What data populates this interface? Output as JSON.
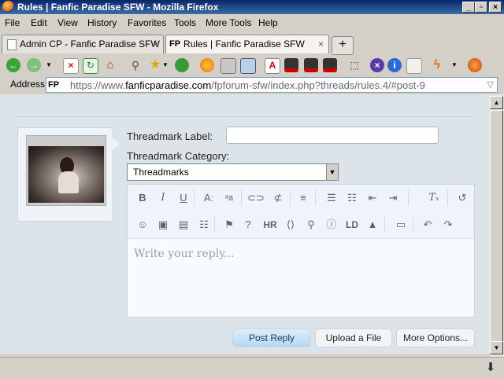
{
  "window": {
    "title": "Rules | Fanfic Paradise SFW - Mozilla Firefox"
  },
  "menu": [
    "File",
    "Edit",
    "View",
    "History",
    "Favorites",
    "Tools",
    "More Tools",
    "Help"
  ],
  "tabs": [
    {
      "label": "Admin CP - Fanfic Paradise SFW",
      "active": false
    },
    {
      "label": "Rules | Fanfic Paradise SFW",
      "active": true,
      "favicon_text": "FP"
    }
  ],
  "address": {
    "label": "Address",
    "site_badge": "FP",
    "url_prefix": "https://www.",
    "url_domain": "fanficparadise.com",
    "url_rest": "/fpforum-sfw/index.php?threads/rules.4/#post-9"
  },
  "form": {
    "threadmark_label": "Threadmark Label:",
    "threadmark_label_value": "",
    "threadmark_category": "Threadmark Category:",
    "category_selected": "Threadmarks",
    "editor_placeholder": "Write your reply...",
    "toolbar_text": {
      "hr": "HR",
      "ld": "LD"
    }
  },
  "buttons": {
    "post_reply": "Post Reply",
    "upload_file": "Upload a File",
    "more_options": "More Options..."
  }
}
